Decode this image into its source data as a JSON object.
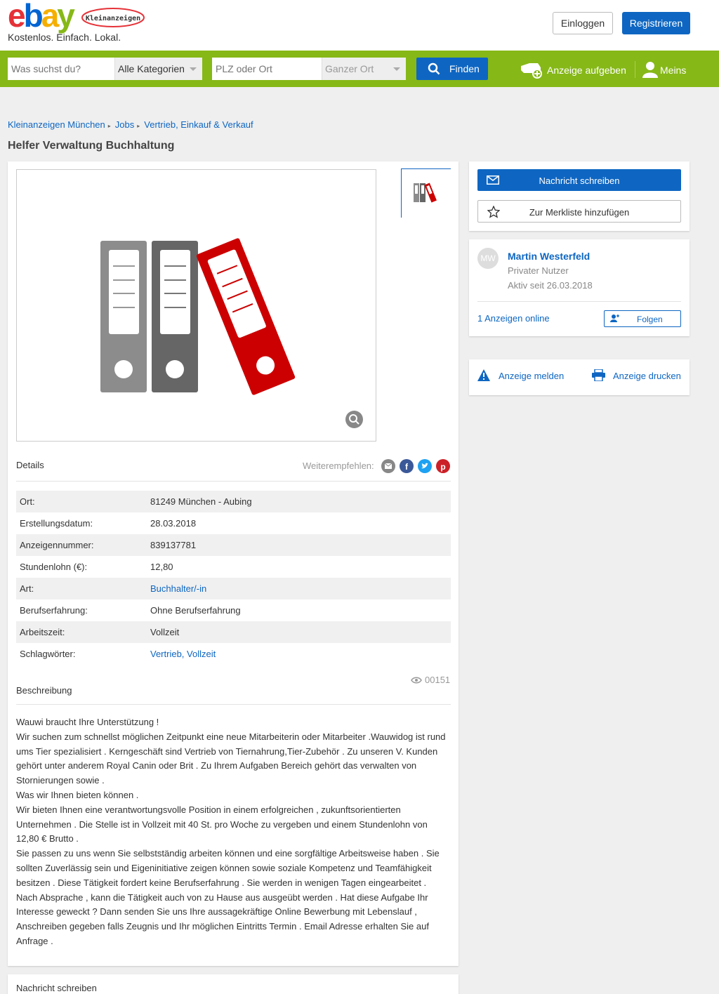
{
  "header": {
    "logo_ebay": "ebay",
    "logo_badge": "Kleinanzeigen",
    "tagline": "Kostenlos. Einfach. Lokal.",
    "login_label": "Einloggen",
    "register_label": "Registrieren"
  },
  "search": {
    "query_placeholder": "Was suchst du?",
    "category_value": "Alle Kategorien",
    "location_placeholder": "PLZ oder Ort",
    "radius_value": "Ganzer Ort",
    "find_label": "Finden",
    "post_ad_label": "Anzeige aufgeben",
    "account_label": "Meins"
  },
  "breadcrumb": [
    "Kleinanzeigen München",
    "Jobs",
    "Vertrieb, Einkauf & Verkauf"
  ],
  "ad": {
    "title": "Helfer Verwaltung Buchhaltung",
    "details_heading": "Details",
    "share_label": "Weiterempfehlen:",
    "details": [
      {
        "key": "Ort:",
        "value": "81249 München - Aubing",
        "link": false
      },
      {
        "key": "Erstellungsdatum:",
        "value": "28.03.2018",
        "link": false
      },
      {
        "key": "Anzeigennummer:",
        "value": "839137781",
        "link": false
      },
      {
        "key": "Stundenlohn (€):",
        "value": "12,80",
        "link": false
      },
      {
        "key": "Art:",
        "value": "Buchhalter/-in",
        "link": true
      },
      {
        "key": "Berufserfahrung:",
        "value": "Ohne Berufserfahrung",
        "link": false
      },
      {
        "key": "Arbeitszeit:",
        "value": "Vollzeit",
        "link": false
      },
      {
        "key": "Schlagwörter:",
        "value": "Vertrieb, Vollzeit",
        "link": true
      }
    ],
    "views": "00151",
    "description_heading": "Beschreibung",
    "description_lines": [
      "Wauwi braucht Ihre Unterstützung !",
      "Wir suchen zum schnellst möglichen Zeitpunkt eine neue Mitarbeiterin oder Mitarbeiter .Wauwidog ist rund",
      "ums Tier spezialisiert . Kerngeschäft sind Vertrieb von Tiernahrung,Tier-Zubehör . Zu unseren V. Kunden",
      "gehört unter anderem Royal Canin oder Brit . Zu Ihrem Aufgaben Bereich gehört das verwalten von",
      "Stornierungen sowie .",
      "Was wir Ihnen bieten können .",
      "Wir bieten Ihnen eine verantwortungsvolle Position in einem erfolgreichen , zukunftsorientierten",
      "Unternehmen . Die Stelle ist in Vollzeit mit 40 St. pro Woche zu vergeben und einem Stundenlohn von",
      "12,80 € Brutto .",
      "Sie passen zu uns wenn Sie selbstständig arbeiten können und eine sorgfältige Arbeitsweise haben . Sie",
      "sollten Zuverlässig sein und Eigeninitiative zeigen können sowie soziale Kompetenz und Teamfähigkeit",
      "besitzen . Diese Tätigkeit fordert keine Berufserfahrung . Sie werden in wenigen Tagen eingearbeitet .",
      "Nach Absprache , kann die Tätigkeit auch von zu Hause aus ausgeübt werden . Hat diese Aufgabe Ihr",
      "Interesse geweckt ? Dann senden Sie uns Ihre aussagekräftige Online Bewerbung mit Lebenslauf ,",
      "Anschreiben gegeben falls Zeugnis und Ihr möglichen Eintritts Termin . Email Adresse erhalten Sie auf",
      "Anfrage ."
    ],
    "bottom_heading": "Nachricht schreiben"
  },
  "sidebar": {
    "message_label": "Nachricht schreiben",
    "watchlist_label": "Zur Merkliste hinzufügen",
    "seller_initials": "MW",
    "seller_name": "Martin Westerfeld",
    "seller_type": "Privater Nutzer",
    "seller_since": "Aktiv seit 26.03.2018",
    "seller_ads": "1 Anzeigen online",
    "follow_label": "Folgen",
    "report_label": "Anzeige melden",
    "print_label": "Anzeige drucken"
  },
  "colors": {
    "brand_green": "#86b817",
    "link_blue": "#0e66c2",
    "binder_red": "#cc0000"
  }
}
